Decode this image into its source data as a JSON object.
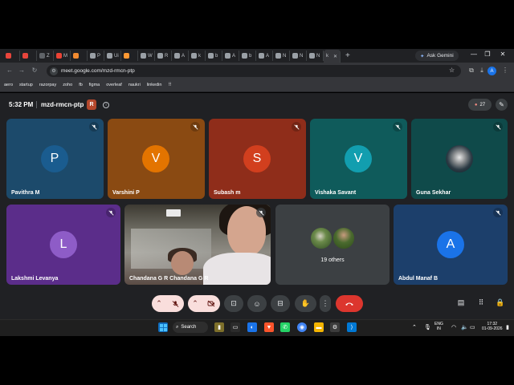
{
  "browser": {
    "tabs": [
      {
        "icon": "tab-icon-red",
        "color": "#e8453c",
        "label": ""
      },
      {
        "icon": "tab-icon-gear",
        "color": "#e8453c",
        "label": ""
      },
      {
        "icon": "tab-icon-z",
        "color": "#5f6368",
        "label": "Z"
      },
      {
        "icon": "tab-icon-gmail",
        "color": "#ea4335",
        "label": "M"
      },
      {
        "icon": "tab-icon-orange",
        "color": "#f28b30",
        "label": ""
      },
      {
        "icon": "tab-icon-generic",
        "color": "#9aa0a6",
        "label": "P"
      },
      {
        "icon": "tab-icon-generic",
        "color": "#9aa0a6",
        "label": "Ui"
      },
      {
        "icon": "tab-icon-flag",
        "color": "#ff9933",
        "label": ""
      },
      {
        "icon": "tab-icon-generic",
        "color": "#9aa0a6",
        "label": "W"
      },
      {
        "icon": "tab-icon-generic",
        "color": "#9aa0a6",
        "label": "R"
      },
      {
        "icon": "tab-icon-generic",
        "color": "#9aa0a6",
        "label": "A"
      },
      {
        "icon": "tab-icon-generic",
        "color": "#9aa0a6",
        "label": "k"
      },
      {
        "icon": "tab-icon-generic",
        "color": "#9aa0a6",
        "label": "b"
      },
      {
        "icon": "tab-icon-generic",
        "color": "#9aa0a6",
        "label": "A"
      },
      {
        "icon": "tab-icon-generic",
        "color": "#9aa0a6",
        "label": "b"
      },
      {
        "icon": "tab-icon-generic",
        "color": "#9aa0a6",
        "label": "A"
      },
      {
        "icon": "tab-icon-generic",
        "color": "#9aa0a6",
        "label": "N"
      },
      {
        "icon": "tab-icon-generic",
        "color": "#9aa0a6",
        "label": "N"
      },
      {
        "icon": "tab-icon-generic",
        "color": "#9aa0a6",
        "label": "N"
      }
    ],
    "active_tab_label": "k",
    "gemini_label": "Ask Gemini",
    "url": "meet.google.com/mzd-rmcn-ptp",
    "profile_initial": "A",
    "bookmarks": [
      {
        "label": "aero",
        "color": "#8ab4f8"
      },
      {
        "label": "startup",
        "color": "#fdd663"
      },
      {
        "label": "razorpay",
        "color": "#4285f4"
      },
      {
        "label": "zoho",
        "color": "#34a853"
      },
      {
        "label": "fb",
        "color": "#1877f2"
      },
      {
        "label": "figma",
        "color": "#f24e1e"
      },
      {
        "label": "overleaf",
        "color": "#47a141"
      },
      {
        "label": "naukri",
        "color": "#4a90e2"
      },
      {
        "label": "linkedin",
        "color": "#0a66c2"
      }
    ]
  },
  "meet": {
    "time": "5:32 PM",
    "meeting_code": "mzd-rmcn-ptp",
    "app_badge": "R",
    "participant_count": "27",
    "tiles": [
      {
        "name": "Pavithra M",
        "initial": "P",
        "bg": "#1c4a6b",
        "avatar_color": "#1a5c8f"
      },
      {
        "name": "Varshini P",
        "initial": "V",
        "bg": "#8a4a12",
        "avatar_color": "#e37400"
      },
      {
        "name": "Subash m",
        "initial": "S",
        "bg": "#8f2d1a",
        "avatar_color": "#d23f1e"
      },
      {
        "name": "Vishaka Savant",
        "initial": "V",
        "bg": "#0f5b5b",
        "avatar_color": "#129eaf"
      },
      {
        "name": "Guna Sekhar",
        "initial": "",
        "bg": "#0f4a4a",
        "avatar_color": ""
      },
      {
        "name": "Lakshmi Levanya",
        "initial": "L",
        "bg": "#5b2d8a",
        "avatar_color": "#8e5cc7"
      },
      {
        "name": "Chandana G R Chandana G R",
        "initial": "",
        "bg": "",
        "avatar_color": ""
      },
      {
        "name": "19 others",
        "initial": "",
        "bg": "#3c4043",
        "avatar_color": ""
      },
      {
        "name": "Abdul Manaf B",
        "initial": "A",
        "bg": "#1c3f6b",
        "avatar_color": "#1a73e8"
      }
    ]
  },
  "taskbar": {
    "search_label": "Search",
    "lang_top": "ENG",
    "lang_bottom": "IN",
    "clock_time": "17:32",
    "clock_date": "01-09-2026"
  }
}
